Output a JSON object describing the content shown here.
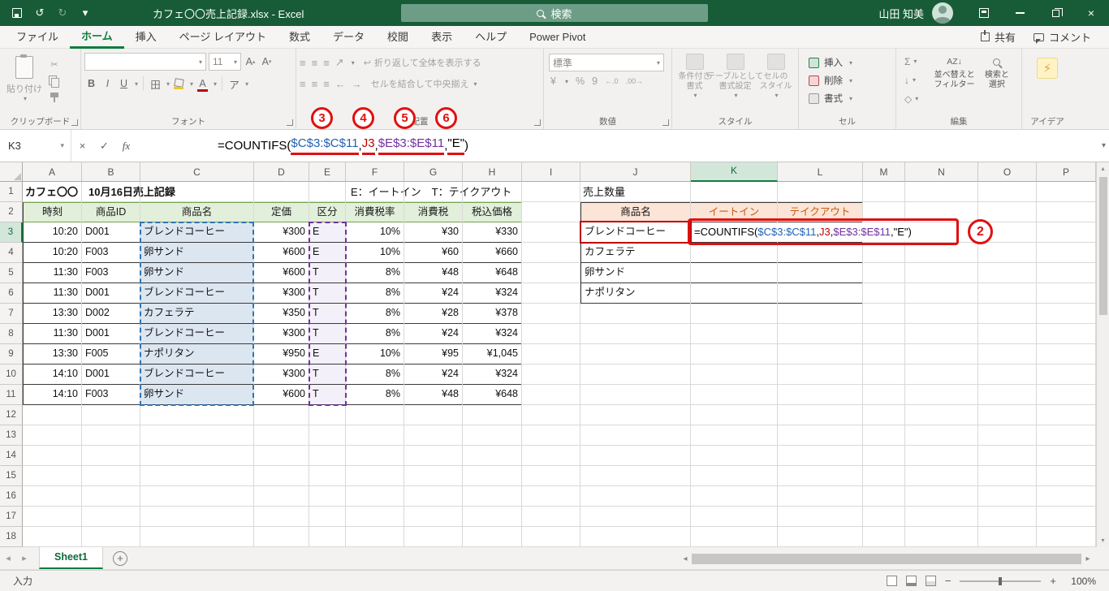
{
  "titlebar": {
    "title": "カフェ〇〇売上記録.xlsx  -  Excel",
    "search_placeholder": "検索",
    "user_name": "山田 知美"
  },
  "ribbon": {
    "tabs": [
      {
        "label": "ファイル",
        "active": false
      },
      {
        "label": "ホーム",
        "active": true
      },
      {
        "label": "挿入",
        "active": false
      },
      {
        "label": "ページ レイアウト",
        "active": false
      },
      {
        "label": "数式",
        "active": false
      },
      {
        "label": "データ",
        "active": false
      },
      {
        "label": "校閲",
        "active": false
      },
      {
        "label": "表示",
        "active": false
      },
      {
        "label": "ヘルプ",
        "active": false
      },
      {
        "label": "Power Pivot",
        "active": false
      }
    ],
    "share_label": "共有",
    "comments_label": "コメント",
    "clipboard": {
      "paste": "貼り付け",
      "label": "クリップボード"
    },
    "font": {
      "name_value": "",
      "size_value": "11",
      "label": "フォント"
    },
    "alignment": {
      "wrap": "折り返して全体を表示する",
      "merge": "セルを結合して中央揃え",
      "label": "配置"
    },
    "number": {
      "format_value": "標準",
      "label": "数値"
    },
    "styles": {
      "conditional": [
        "条件付き",
        "書式"
      ],
      "format_table": [
        "テーブルとして",
        "書式設定"
      ],
      "cell_styles": [
        "セルの",
        "スタイル"
      ],
      "label": "スタイル"
    },
    "cells": {
      "insert": "挿入",
      "delete": "削除",
      "format": "書式",
      "label": "セル"
    },
    "editing": {
      "sort": [
        "並べ替えと",
        "フィルター"
      ],
      "find": [
        "検索と",
        "選択"
      ],
      "label": "編集"
    },
    "ideas": {
      "label": "アイデア"
    }
  },
  "formula_bar": {
    "name_box": "K3",
    "fx_label": "fx",
    "formula_parts": [
      {
        "text": "=COUNTIFS(",
        "color": "#000000",
        "underline": false
      },
      {
        "text": "$C$3:$C$11",
        "color": "#1F62B4",
        "underline": true
      },
      {
        "text": ",",
        "color": "#000000",
        "underline": false
      },
      {
        "text": "J3",
        "color": "#C00000",
        "underline": true
      },
      {
        "text": ",",
        "color": "#000000",
        "underline": false
      },
      {
        "text": "$E$3:$E$11",
        "color": "#7030A0",
        "underline": true
      },
      {
        "text": ",",
        "color": "#000000",
        "underline": false
      },
      {
        "text": "\"E\"",
        "color": "#000000",
        "underline": true
      },
      {
        "text": ")",
        "color": "#000000",
        "underline": false
      }
    ]
  },
  "grid": {
    "columns": [
      "A",
      "B",
      "C",
      "D",
      "E",
      "F",
      "G",
      "H",
      "I",
      "J",
      "K",
      "L",
      "M",
      "N",
      "O",
      "P"
    ],
    "row_count": 18,
    "active_column": "K",
    "active_row": 3
  },
  "sheet": {
    "a1_title": "カフェ〇〇　10月16日売上記録",
    "legend": "E：イートイン　T：テイクアウト",
    "summary_title": "売上数量",
    "main_table": {
      "headers": [
        "時刻",
        "商品ID",
        "商品名",
        "定価",
        "区分",
        "消費税率",
        "消費税",
        "税込価格"
      ],
      "rows": [
        [
          "10:20",
          "D001",
          "ブレンドコーヒー",
          "¥300",
          "E",
          "10%",
          "¥30",
          "¥330"
        ],
        [
          "10:20",
          "F003",
          "卵サンド",
          "¥600",
          "E",
          "10%",
          "¥60",
          "¥660"
        ],
        [
          "11:30",
          "F003",
          "卵サンド",
          "¥600",
          "T",
          "8%",
          "¥48",
          "¥648"
        ],
        [
          "11:30",
          "D001",
          "ブレンドコーヒー",
          "¥300",
          "T",
          "8%",
          "¥24",
          "¥324"
        ],
        [
          "13:30",
          "D002",
          "カフェラテ",
          "¥350",
          "T",
          "8%",
          "¥28",
          "¥378"
        ],
        [
          "11:30",
          "D001",
          "ブレンドコーヒー",
          "¥300",
          "T",
          "8%",
          "¥24",
          "¥324"
        ],
        [
          "13:30",
          "F005",
          "ナポリタン",
          "¥950",
          "E",
          "10%",
          "¥95",
          "¥1,045"
        ],
        [
          "14:10",
          "D001",
          "ブレンドコーヒー",
          "¥300",
          "T",
          "8%",
          "¥24",
          "¥324"
        ],
        [
          "14:10",
          "F003",
          "卵サンド",
          "¥600",
          "T",
          "8%",
          "¥48",
          "¥648"
        ]
      ]
    },
    "summary_table": {
      "headers": [
        "商品名",
        "イートイン",
        "テイクアウト"
      ],
      "products": [
        "ブレンドコーヒー",
        "カフェラテ",
        "卵サンド",
        "ナポリタン"
      ]
    }
  },
  "callouts": {
    "n2": "2",
    "n3": "3",
    "n4": "4",
    "n5": "5",
    "n6": "6"
  },
  "sheet_tabs": {
    "active_tab": "Sheet1"
  },
  "status_bar": {
    "mode": "入力",
    "zoom_level": "100%"
  },
  "glyphs": {
    "dd": "▾",
    "up": "▴",
    "dn": "▾",
    "left": "◂",
    "right": "▸",
    "minus": "−",
    "plus": "+",
    "cancel": "×",
    "check": "✓",
    "undo": "↺",
    "redo": "↻",
    "letter_a": "A",
    "bold": "B",
    "italic": "I",
    "underline": "U",
    "borders": "田",
    "font_color_letter": "A",
    "ruby": "ア",
    "align": "≡",
    "orient": "↗",
    "wrap": "↩",
    "indent_left": "←",
    "indent_right": "→",
    "currency": "¥",
    "percent": "%",
    "comma": "9",
    "inc_dec": "←.0",
    "dec_dec": ".00→",
    "sigma": "Σ",
    "fill_down": "↓",
    "clear": "◇",
    "sort_az": "AZ↓",
    "bolt": "⚡"
  },
  "colors": {
    "titlebar_green": "#185C37",
    "accent_green": "#107C41",
    "ref_blue": "#1F62B4",
    "ref_red": "#C00000",
    "ref_purple": "#7030A0",
    "annotation_red": "#E01010",
    "table_header_green": "#E2EFDA",
    "table_header_orange": "#FCE4D6",
    "ref_blue_fill": "#DCE6F1",
    "ref_purple_fill": "#F3F0F9"
  }
}
